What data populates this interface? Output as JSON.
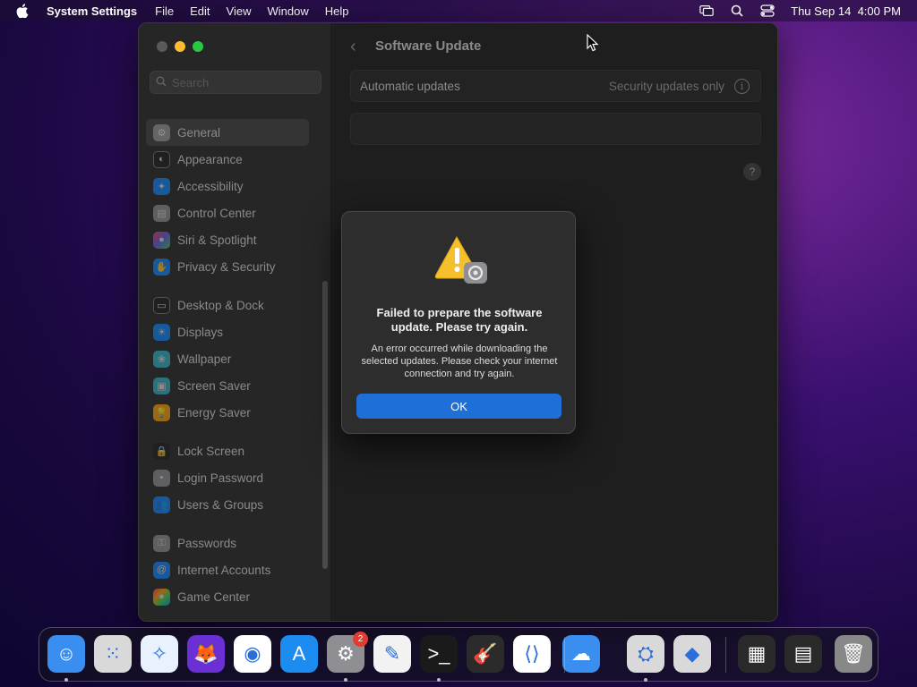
{
  "menubar": {
    "app_name": "System Settings",
    "menus": [
      "File",
      "Edit",
      "View",
      "Window",
      "Help"
    ],
    "clock": "Thu Sep 14  4:00 PM"
  },
  "window": {
    "search": {
      "placeholder": "Search"
    },
    "sidebar": {
      "groups": [
        [
          {
            "label": "General",
            "icon": "gear-icon",
            "color": "#8e8e93",
            "active": true
          },
          {
            "label": "Appearance",
            "icon": "appearance-icon",
            "color": "#1c1c1e"
          },
          {
            "label": "Accessibility",
            "icon": "accessibility-icon",
            "color": "#0a84ff"
          },
          {
            "label": "Control Center",
            "icon": "control-center-icon",
            "color": "#8e8e93"
          },
          {
            "label": "Siri & Spotlight",
            "icon": "siri-icon",
            "color": "#bf5af2"
          },
          {
            "label": "Privacy & Security",
            "icon": "hand-icon",
            "color": "#0a84ff"
          }
        ],
        [
          {
            "label": "Desktop & Dock",
            "icon": "desktop-icon",
            "color": "#1c1c1e"
          },
          {
            "label": "Displays",
            "icon": "sun-icon",
            "color": "#0a84ff"
          },
          {
            "label": "Wallpaper",
            "icon": "wallpaper-icon",
            "color": "#30b0c7"
          },
          {
            "label": "Screen Saver",
            "icon": "screen-saver-icon",
            "color": "#30b0c7"
          },
          {
            "label": "Energy Saver",
            "icon": "bulb-icon",
            "color": "#ff9f0a"
          }
        ],
        [
          {
            "label": "Lock Screen",
            "icon": "lock-icon",
            "color": "#1c1c1e"
          },
          {
            "label": "Login Password",
            "icon": "password-icon",
            "color": "#8e8e93"
          },
          {
            "label": "Users & Groups",
            "icon": "users-icon",
            "color": "#0a84ff"
          }
        ],
        [
          {
            "label": "Passwords",
            "icon": "key-icon",
            "color": "#8e8e93"
          },
          {
            "label": "Internet Accounts",
            "icon": "at-icon",
            "color": "#0a84ff"
          },
          {
            "label": "Game Center",
            "icon": "game-center-icon",
            "color": "#ff375f"
          }
        ]
      ]
    },
    "content": {
      "title": "Software Update",
      "rows": [
        {
          "label": "Automatic updates",
          "value": "Security updates only"
        }
      ]
    }
  },
  "dialog": {
    "title": "Failed to prepare the software update. Please try again.",
    "message": "An error occurred while downloading the selected updates. Please check your internet connection and try again.",
    "ok_label": "OK"
  },
  "dock": {
    "apps": [
      {
        "name": "finder-icon",
        "color": "#3a8ef0",
        "running": true
      },
      {
        "name": "launchpad-icon",
        "color": "#d9d9d9"
      },
      {
        "name": "safari-icon",
        "color": "#e8f2ff"
      },
      {
        "name": "firefox-icon",
        "color": "#6b2fd6"
      },
      {
        "name": "chrome-icon",
        "color": "#ffffff"
      },
      {
        "name": "app-store-icon",
        "color": "#1c8cf0"
      },
      {
        "name": "system-settings-icon",
        "color": "#8e8e93",
        "running": true,
        "badge": "2"
      },
      {
        "name": "textedit-icon",
        "color": "#f2f2f2"
      },
      {
        "name": "terminal-icon",
        "color": "#1a1a1a",
        "running": true
      },
      {
        "name": "garageband-icon",
        "color": "#2b2b2b"
      },
      {
        "name": "vscode-icon",
        "color": "#ffffff"
      },
      {
        "name": "weather-icon",
        "color": "#3a8ef0"
      },
      {
        "name": "disk-utility-icon",
        "color": "#d9d9d9",
        "running": true
      },
      {
        "name": "boot-camp-icon",
        "color": "#d9d9d9"
      },
      {
        "name": "downloads-folder-icon",
        "color": "#2a2a2a"
      },
      {
        "name": "recent-window-icon",
        "color": "#2a2a2a"
      },
      {
        "name": "trash-icon",
        "color": "#888888"
      }
    ]
  }
}
